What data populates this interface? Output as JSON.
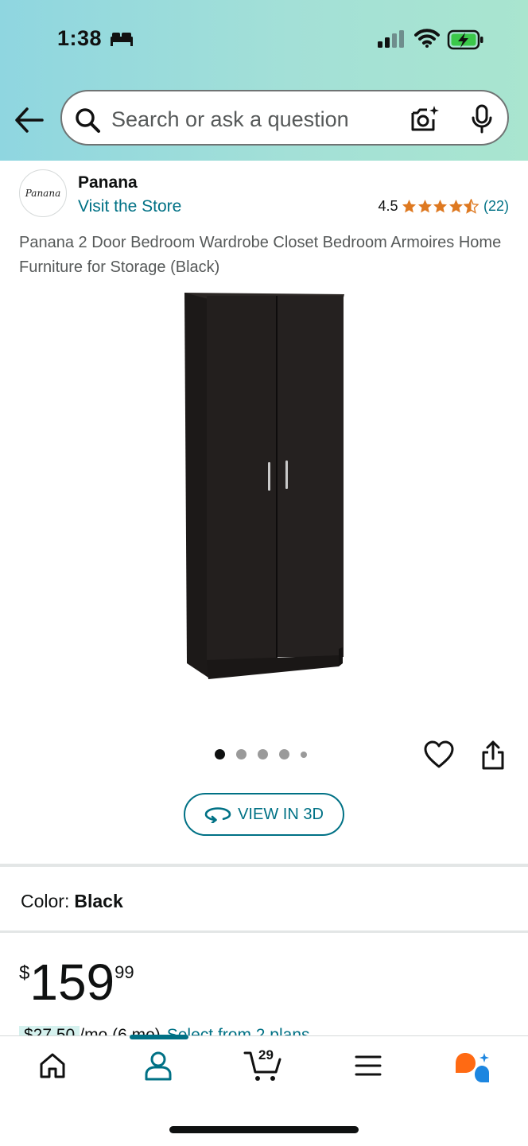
{
  "status_bar": {
    "time": "1:38"
  },
  "search": {
    "placeholder": "Search or ask a question"
  },
  "store": {
    "logo_text": "Panana",
    "name": "Panana",
    "link": "Visit the Store"
  },
  "rating": {
    "value": "4.5",
    "stars": 4.5,
    "count": "(22)",
    "star_color": "#de7921"
  },
  "product": {
    "title": "Panana 2 Door Bedroom Wardrobe Closet Bedroom Armoires Home Furniture for Storage (Black)"
  },
  "gallery": {
    "image_count": 5,
    "active_index": 0
  },
  "view_3d": {
    "label": "VIEW IN 3D"
  },
  "color": {
    "label": "Color:",
    "value": "Black"
  },
  "price": {
    "symbol": "$",
    "whole": "159",
    "fraction": "99"
  },
  "plans": {
    "monthly": "$27.50",
    "term": "/mo (6 mo)",
    "link": "Select from 2 plans"
  },
  "nav": {
    "cart_count": "29",
    "active_tab": "account"
  },
  "colors": {
    "accent": "#007185",
    "header_start": "#8fd6e0",
    "header_end": "#a9e5cf"
  }
}
